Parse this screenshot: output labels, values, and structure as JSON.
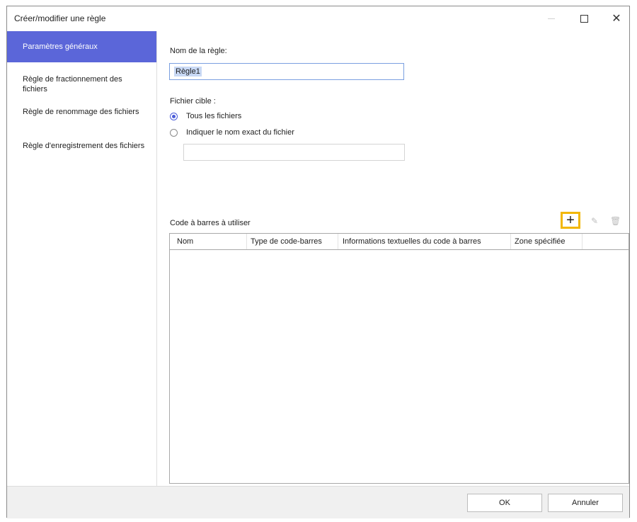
{
  "window": {
    "title": "Créer/modifier une règle",
    "controls": {
      "minimize": "minimize-icon",
      "maximize": "maximize-icon",
      "close": "close-icon"
    }
  },
  "sidebar": {
    "items": [
      {
        "label": "Paramètres généraux",
        "active": true
      },
      {
        "label": "Règle de fractionnement des fichiers",
        "active": false
      },
      {
        "label": "Règle de renommage des fichiers",
        "active": false
      },
      {
        "label": "Règle d'enregistrement des fichiers",
        "active": false
      }
    ]
  },
  "general": {
    "rule_name_label": "Nom de la règle:",
    "rule_name_value": "Règle1",
    "target_label": "Fichier cible :",
    "options": [
      {
        "label": "Tous les fichiers",
        "checked": true
      },
      {
        "label": "Indiquer le nom exact du fichier",
        "checked": false
      }
    ],
    "exact_name_value": ""
  },
  "barcodes": {
    "label": "Code à barres à utiliser",
    "add_symbol": "+",
    "icons": {
      "add": "plus-icon",
      "edit": "pencil-icon",
      "delete": "trash-icon"
    },
    "columns": [
      "Nom",
      "Type de code-barres",
      "Informations textuelles du code à barres",
      "Zone spécifiée"
    ],
    "rows": []
  },
  "footer": {
    "ok_label": "OK",
    "cancel_label": "Annuler"
  },
  "colors": {
    "accent": "#5b66d9",
    "highlight": "#f2b705"
  }
}
